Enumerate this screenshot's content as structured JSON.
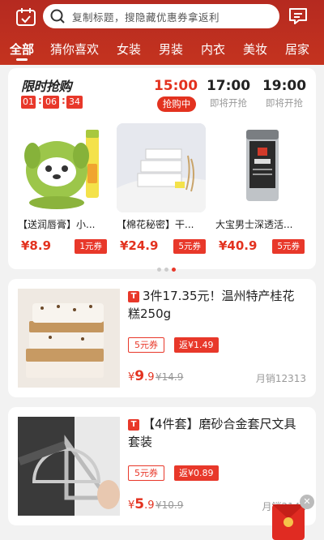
{
  "header": {
    "search_placeholder": "复制标题，搜隐藏优惠券拿返利",
    "left_icon": "calendar-check-icon",
    "right_icon": "message-icon"
  },
  "tabs": [
    "全部",
    "猜你喜欢",
    "女装",
    "男装",
    "内衣",
    "美妆",
    "居家"
  ],
  "flash": {
    "title": "限时抢购",
    "countdown": [
      "01",
      "06",
      "34"
    ],
    "slots": [
      {
        "time": "15:00",
        "status": "抢购中"
      },
      {
        "time": "17:00",
        "status": "即将开抢"
      },
      {
        "time": "19:00",
        "status": "即将开抢"
      }
    ],
    "products": [
      {
        "name": "【送润唇膏】小...",
        "price": "¥8.9",
        "coupon": "1元券"
      },
      {
        "name": "【棉花秘密】干...",
        "price": "¥24.9",
        "coupon": "5元券"
      },
      {
        "name": "大宝男士深透活...",
        "price": "¥40.9",
        "coupon": "5元券"
      }
    ],
    "page_index": 3,
    "page_count": 3
  },
  "items": [
    {
      "badge": "T",
      "title": "3件17.35元！温州特产桂花糕250g",
      "coupon": "5元券",
      "rebate": "返¥1.49",
      "currency": "¥",
      "price_int": "9",
      "price_dec": ".9",
      "orig_price": "¥14.9",
      "sales": "月销12313"
    },
    {
      "badge": "T",
      "title": "【4件套】磨砂合金套尺文具套装",
      "coupon": "5元券",
      "rebate": "返¥0.89",
      "currency": "¥",
      "price_int": "5",
      "price_dec": ".9",
      "orig_price": "¥10.9",
      "sales": "月销2141"
    }
  ],
  "floating": {
    "close": "✕"
  },
  "colors": {
    "brand_red": "#e3321f",
    "header_red": "#b52a20"
  }
}
